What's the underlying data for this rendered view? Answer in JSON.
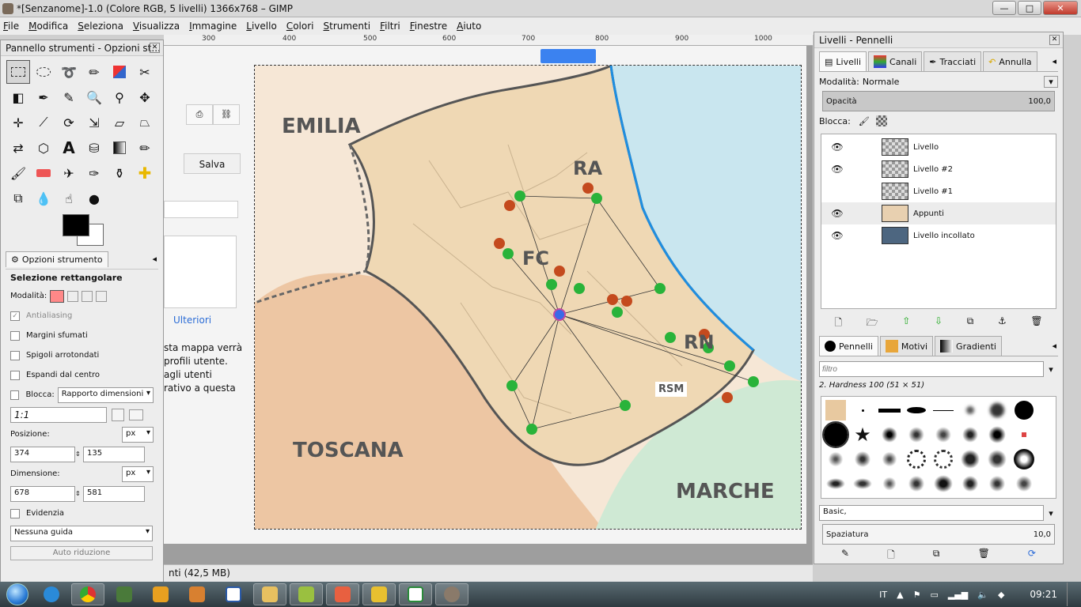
{
  "window": {
    "title": "*[Senzanome]-1.0 (Colore RGB, 5 livelli) 1366x768 – GIMP",
    "buttons": [
      "minimize",
      "maximize",
      "close"
    ]
  },
  "menu": [
    "File",
    "Modifica",
    "Seleziona",
    "Visualizza",
    "Immagine",
    "Livello",
    "Colori",
    "Strumenti",
    "Filtri",
    "Finestre",
    "Aiuto"
  ],
  "ruler": [
    "300",
    "400",
    "500",
    "600",
    "700",
    "800",
    "900",
    "1000"
  ],
  "webpage": {
    "save_button": "Salva",
    "more_link": "Ulteriori",
    "text_lines": [
      "sta mappa verrà",
      "profili utente.",
      "agli utenti",
      "rativo a questa"
    ]
  },
  "map": {
    "regions": [
      "EMILIA",
      "TOSCANA",
      "MARCHE",
      "RA",
      "FC",
      "RN",
      "RSM"
    ]
  },
  "status": "nti (42,5 MB)",
  "toolbox": {
    "title": "Pannello strumenti - Opzioni st...",
    "options_tab": "Opzioni strumento",
    "tool_name": "Selezione rettangolare",
    "mode_label": "Modalità:",
    "antialiasing": "Antialiasing",
    "feather": "Margini sfumati",
    "rounded": "Spigoli arrotondati",
    "expand": "Espandi dal centro",
    "lock_label": "Blocca:",
    "lock_value": "Rapporto dimensioni",
    "ratio": "1:1",
    "position_label": "Posizione:",
    "pos_unit": "px",
    "pos_x": "374",
    "pos_y": "135",
    "size_label": "Dimensione:",
    "size_unit": "px",
    "size_w": "678",
    "size_h": "581",
    "highlight": "Evidenzia",
    "guide": "Nessuna guida",
    "auto_shrink": "Auto riduzione"
  },
  "dock": {
    "title": "Livelli - Pennelli",
    "tabs": [
      "Livelli",
      "Canali",
      "Tracciati",
      "Annulla"
    ],
    "mode_label": "Modalità:",
    "mode_value": "Normale",
    "opacity_label": "Opacità",
    "opacity_value": "100,0",
    "lock_label": "Blocca:",
    "layers": [
      {
        "name": "Livello",
        "visible": true
      },
      {
        "name": "Livello #2",
        "visible": true
      },
      {
        "name": "Livello #1",
        "visible": false
      },
      {
        "name": "Appunti",
        "visible": true
      },
      {
        "name": "Livello incollato",
        "visible": true
      }
    ],
    "brush_tabs": [
      "Pennelli",
      "Motivi",
      "Gradienti"
    ],
    "filter_placeholder": "filtro",
    "brush_name": "2. Hardness 100 (51 × 51)",
    "brush_set": "Basic,",
    "spacing_label": "Spaziatura",
    "spacing_value": "10,0"
  },
  "taskbar": {
    "language": "IT",
    "time": "09:21"
  }
}
